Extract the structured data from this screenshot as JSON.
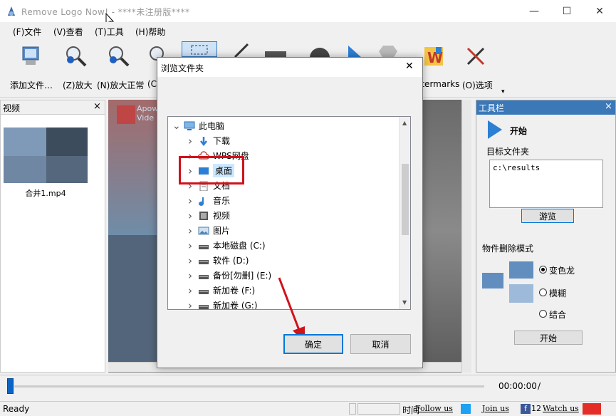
{
  "window": {
    "title": "Remove Logo Now! - ****未注册版****",
    "minimize": "—",
    "maximize": "☐",
    "close": "✕"
  },
  "menubar": {
    "items": [
      "(F)文件",
      "(V)查看",
      "(T)工具",
      "(H)帮助"
    ]
  },
  "toolbar": {
    "add_file": "添加文件…",
    "zoom_in": "(Z)放大",
    "zoom_normal": "(N)放大正常",
    "zoom_partial": "(C",
    "watermarks": "atermarks",
    "options": "(O)选项",
    "more": "▾"
  },
  "video_panel": {
    "title": "视频",
    "close": "×",
    "item_label": "合并1.mp4"
  },
  "preview": {
    "watermark_text": "Apow\nVide"
  },
  "tools_panel": {
    "title": "工具栏",
    "close": "×",
    "start_label": "开始",
    "target_folder_label": "目标文件夹",
    "target_folder_value": "c:\\results",
    "browse_button": "游览",
    "removal_mode_label": "物件删除模式",
    "modes": [
      "变色龙",
      "模糊",
      "结合"
    ],
    "selected_mode": "变色龙",
    "start_button": "开始"
  },
  "timeline": {
    "time": "00:00:00",
    "separator": "/"
  },
  "statusbar": {
    "status": "Ready",
    "time_label": "时间",
    "follow": "Follow us",
    "join": "Join us",
    "watch": "Watch us",
    "number": "12"
  },
  "dialog": {
    "title": "浏览文件夹",
    "close": "✕",
    "tree": [
      {
        "label": "此电脑",
        "indent": 0,
        "expanded": true,
        "icon": "computer-icon"
      },
      {
        "label": "下载",
        "indent": 1,
        "icon": "download-icon"
      },
      {
        "label": "WPS网盘",
        "indent": 1,
        "icon": "cloud-icon"
      },
      {
        "label": "桌面",
        "indent": 1,
        "icon": "desktop-icon",
        "selected": true
      },
      {
        "label": "文档",
        "indent": 1,
        "icon": "document-icon"
      },
      {
        "label": "音乐",
        "indent": 1,
        "icon": "music-icon"
      },
      {
        "label": "视频",
        "indent": 1,
        "icon": "video-icon"
      },
      {
        "label": "图片",
        "indent": 1,
        "icon": "picture-icon"
      },
      {
        "label": "本地磁盘 (C:)",
        "indent": 1,
        "icon": "drive-icon"
      },
      {
        "label": "软件 (D:)",
        "indent": 1,
        "icon": "drive-icon"
      },
      {
        "label": "备份[勿删] (E:)",
        "indent": 1,
        "icon": "drive-icon"
      },
      {
        "label": "新加卷 (F:)",
        "indent": 1,
        "icon": "drive-icon"
      },
      {
        "label": "新加卷 (G:)",
        "indent": 1,
        "icon": "drive-icon"
      }
    ],
    "ok_button": "确定",
    "cancel_button": "取消"
  },
  "colors": {
    "highlight_red": "#d0121b",
    "arrow_red": "#d0121b",
    "accent_blue": "#0078d7"
  }
}
